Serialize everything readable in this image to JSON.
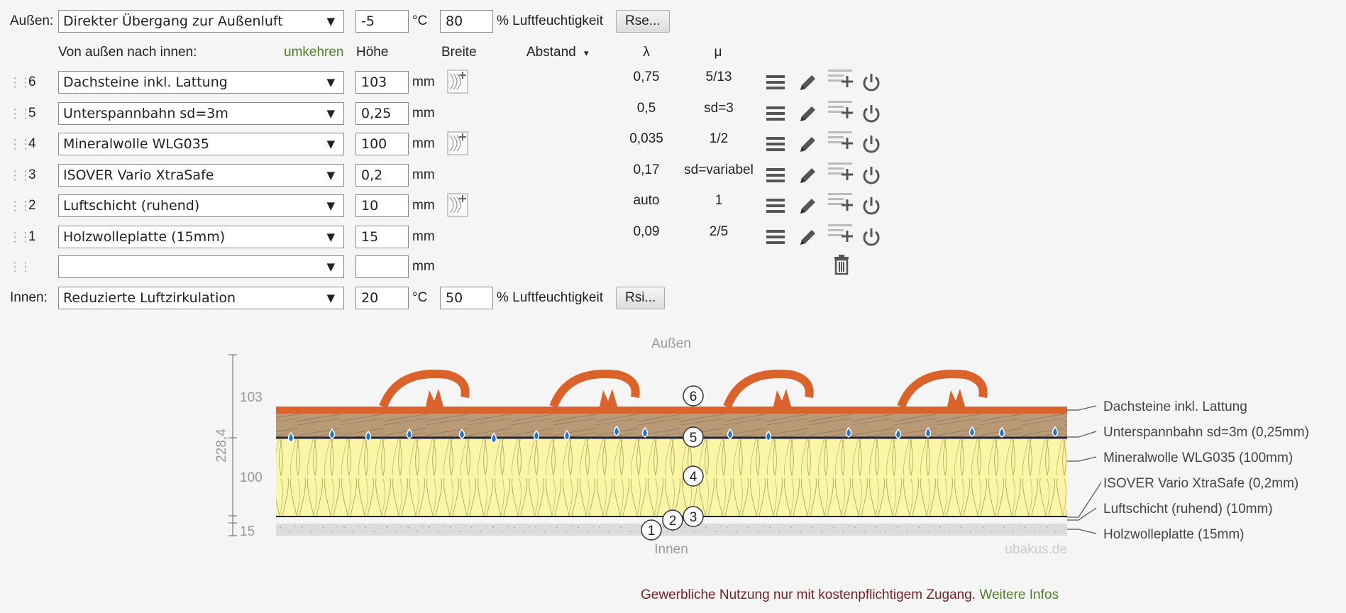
{
  "outside": {
    "label": "Außen:",
    "condition": "Direkter Übergang zur Außenluft",
    "temperature": "-5",
    "temp_unit": "°C",
    "humidity": "80",
    "humidity_label": "% Luftfeuchtigkeit",
    "button": "Rse..."
  },
  "header": {
    "direction": "Von außen nach innen:",
    "reverse": "umkehren",
    "height": "Höhe",
    "width": "Breite",
    "distance": "Abstand",
    "distance_arrow": "▾",
    "lambda": "λ",
    "mu": "μ"
  },
  "layers": [
    {
      "index": "6",
      "material": "Dachsteine inkl. Lattung",
      "height": "103",
      "unit": "mm",
      "hatch": true,
      "lambda": "0,75",
      "mu": "5/13"
    },
    {
      "index": "5",
      "material": "Unterspannbahn sd=3m",
      "height": "0,25",
      "unit": "mm",
      "hatch": false,
      "lambda": "0,5",
      "mu": "sd=3"
    },
    {
      "index": "4",
      "material": "Mineralwolle WLG035",
      "height": "100",
      "unit": "mm",
      "hatch": true,
      "lambda": "0,035",
      "mu": "1/2"
    },
    {
      "index": "3",
      "material": "ISOVER Vario XtraSafe",
      "height": "0,2",
      "unit": "mm",
      "hatch": false,
      "lambda": "0,17",
      "mu": "sd=variabel"
    },
    {
      "index": "2",
      "material": "Luftschicht (ruhend)",
      "height": "10",
      "unit": "mm",
      "hatch": true,
      "lambda": "auto",
      "mu": "1"
    },
    {
      "index": "1",
      "material": "Holzwolleplatte (15mm)",
      "height": "15",
      "unit": "mm",
      "hatch": false,
      "lambda": "0,09",
      "mu": "2/5"
    }
  ],
  "new_layer": {
    "material": "",
    "height": "",
    "unit": "mm"
  },
  "inside": {
    "label": "Innen:",
    "condition": "Reduzierte Luftzirkulation",
    "temperature": "20",
    "temp_unit": "°C",
    "humidity": "50",
    "humidity_label": "% Luftfeuchtigkeit",
    "button": "Rsi..."
  },
  "diagram": {
    "top_label": "Außen",
    "bottom_label": "Innen",
    "watermark": "ubakus.de",
    "total_dim": "228,4",
    "dim_103": "103",
    "dim_100": "100",
    "dim_15": "15",
    "callouts": [
      "Dachsteine inkl. Lattung",
      "Unterspannbahn sd=3m (0,25mm)",
      "Mineralwolle WLG035 (100mm)",
      "ISOVER Vario XtraSafe (0,2mm)",
      "Luftschicht (ruhend) (10mm)",
      "Holzwolleplatte (15mm)"
    ],
    "markers": [
      "6",
      "5",
      "4",
      "3",
      "2",
      "1"
    ]
  },
  "footer": {
    "notice": "Gewerbliche Nutzung nur mit kostenpflichtigem Zugang.",
    "link": "Weitere Infos"
  },
  "colors": {
    "tile": "#d9632a",
    "wood": "#b99a77",
    "insulation": "#fbf6a6",
    "drop": "#1e73d6",
    "green": "#4f7f2d",
    "notice": "#7a1f1f"
  }
}
